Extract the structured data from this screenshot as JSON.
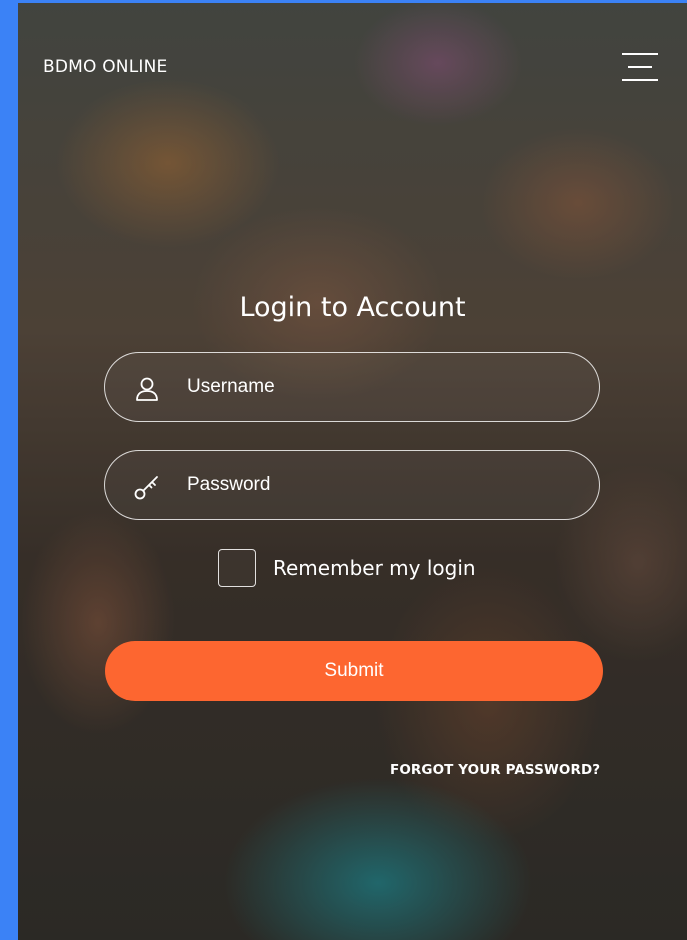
{
  "header": {
    "brand": "BDMO ONLINE",
    "menu_icon": "hamburger-menu-icon"
  },
  "login": {
    "title": "Login to Account",
    "username": {
      "placeholder": "Username",
      "value": "",
      "icon": "user-icon"
    },
    "password": {
      "placeholder": "Password",
      "value": "",
      "icon": "key-icon"
    },
    "remember_label": "Remember my login",
    "remember_checked": false,
    "submit_label": "Submit",
    "forgot_label": "FORGOT YOUR PASSWORD?"
  },
  "colors": {
    "accent": "#fd6630",
    "page_border": "#3b82f6",
    "text": "#ffffff"
  }
}
